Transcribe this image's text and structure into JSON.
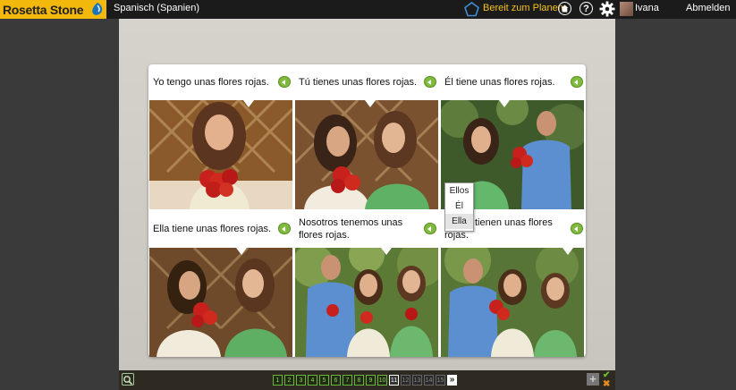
{
  "header": {
    "brand": "Rosetta Stone",
    "course": "Spanisch (Spanien)",
    "plan_label": "Bereit zum Planen",
    "help_label": "?",
    "user_name": "Ivana",
    "logout_label": "Abmelden"
  },
  "lesson": {
    "cards": [
      {
        "caption": "Yo tengo unas flores rojas."
      },
      {
        "caption": "Tú tienes unas flores rojas."
      },
      {
        "caption": "Él tiene unas flores rojas."
      },
      {
        "caption": "Ella tiene unas flores rojas."
      },
      {
        "caption": "Nosotros tenemos unas flores rojas."
      },
      {
        "caption": "tienen unas flores rojas."
      }
    ],
    "dropdown": {
      "options": [
        "Ellos",
        "Él",
        "Ella"
      ],
      "highlighted": "Ella"
    }
  },
  "footer": {
    "pages": [
      "1",
      "2",
      "3",
      "4",
      "5",
      "6",
      "7",
      "8",
      "9",
      "10",
      "11",
      "12",
      "13",
      "14",
      "15"
    ],
    "completed_count": 10,
    "current_page": "11",
    "next_label": "»",
    "add_label": "+",
    "check_label": "✔",
    "cross_label": "✖"
  }
}
